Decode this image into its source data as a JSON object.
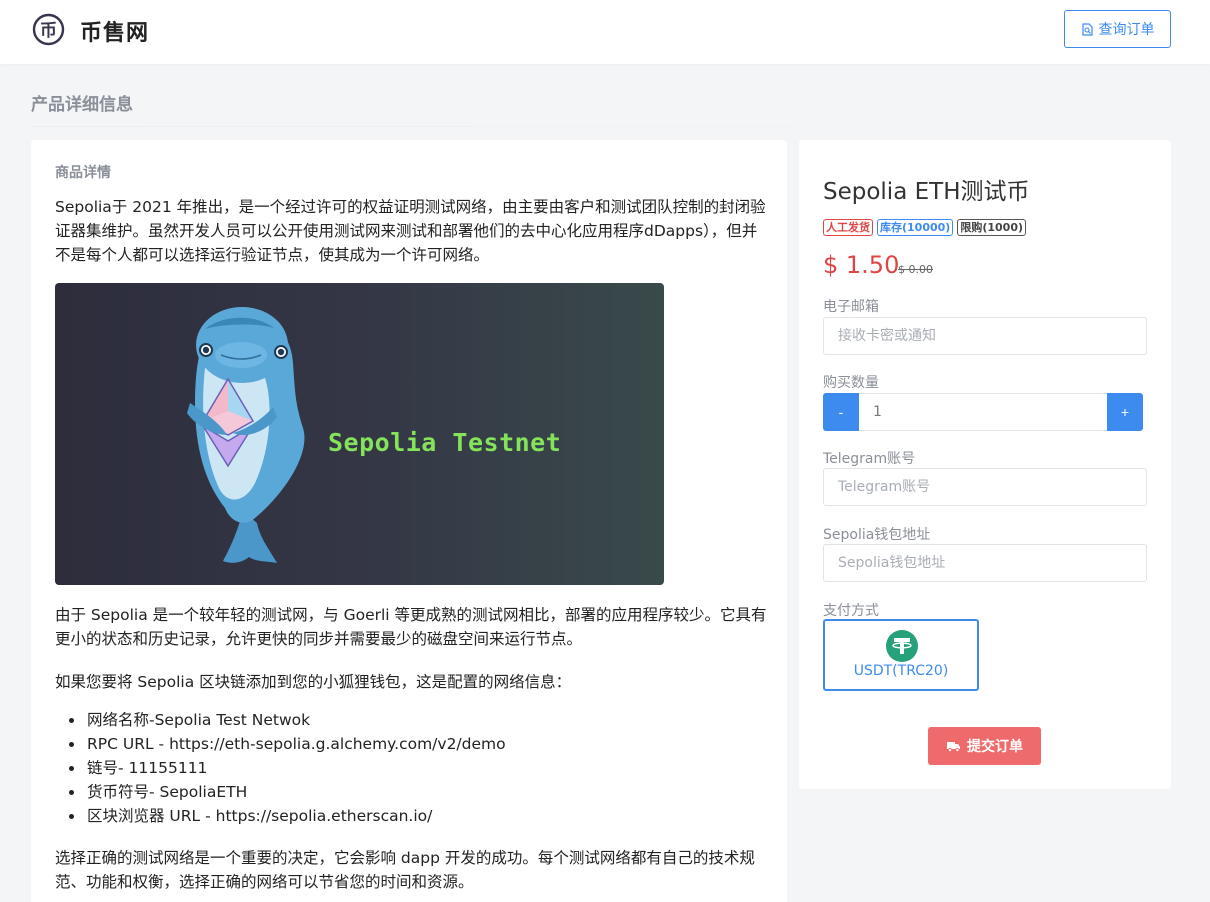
{
  "header": {
    "site_name": "币售网",
    "logo_char": "币",
    "order_query_label": "查询订单"
  },
  "section": {
    "title": "产品详细信息"
  },
  "details": {
    "subtitle": "商品详情",
    "intro": "Sepolia于 2021 年推出，是一个经过许可的权益证明测试网络，由主要由客户和测试团队控制的封闭验证器集维护。虽然开发人员可以公开使用测试网来测试和部署他们的去中心化应用程序dDapps），但并不是每个人都可以选择运行验证节点，使其成为一个许可网络。",
    "banner_text": "Sepolia Testnet",
    "para2": "由于 Sepolia 是一个较年轻的测试网，与 Goerli 等更成熟的测试网相比，部署的应用程序较少。它具有更小的状态和历史记录，允许更快的同步并需要最少的磁盘空间来运行节点。",
    "para3": "如果您要将 Sepolia 区块链添加到您的小狐狸钱包，这是配置的网络信息：",
    "network_items": [
      "网络名称-Sepolia Test Netwok",
      "RPC URL - https://eth-sepolia.g.alchemy.com/v2/demo",
      "链号- 11155111",
      "货币符号- SepoliaETH",
      "区块浏览器 URL - https://sepolia.etherscan.io/"
    ],
    "para4": "选择正确的测试网络是一个重要的决定，它会影响 dapp 开发的成功。每个测试网络都有自己的技术规范、功能和权衡，选择正确的网络可以节省您的时间和资源。"
  },
  "product": {
    "title": "Sepolia ETH测试币",
    "badges": {
      "delivery": "人工发货",
      "stock": "库存(10000)",
      "limit": "限购(1000)"
    },
    "price": "$ 1.50",
    "old_price": "$ 0.00",
    "email": {
      "label": "电子邮箱",
      "placeholder": "接收卡密或通知"
    },
    "quantity": {
      "label": "购买数量",
      "value": "1",
      "minus": "-",
      "plus": "+"
    },
    "telegram": {
      "label": "Telegram账号",
      "placeholder": "Telegram账号"
    },
    "wallet": {
      "label": "Sepolia钱包地址",
      "placeholder": "Sepolia钱包地址"
    },
    "payment": {
      "label": "支付方式",
      "option": "USDT(TRC20)"
    },
    "submit_label": "提交订单"
  },
  "colors": {
    "accent": "#3d8bef",
    "price": "#e04545",
    "submit": "#ef6b6b",
    "usdt": "#26a17b",
    "banner_text": "#85e35a"
  }
}
